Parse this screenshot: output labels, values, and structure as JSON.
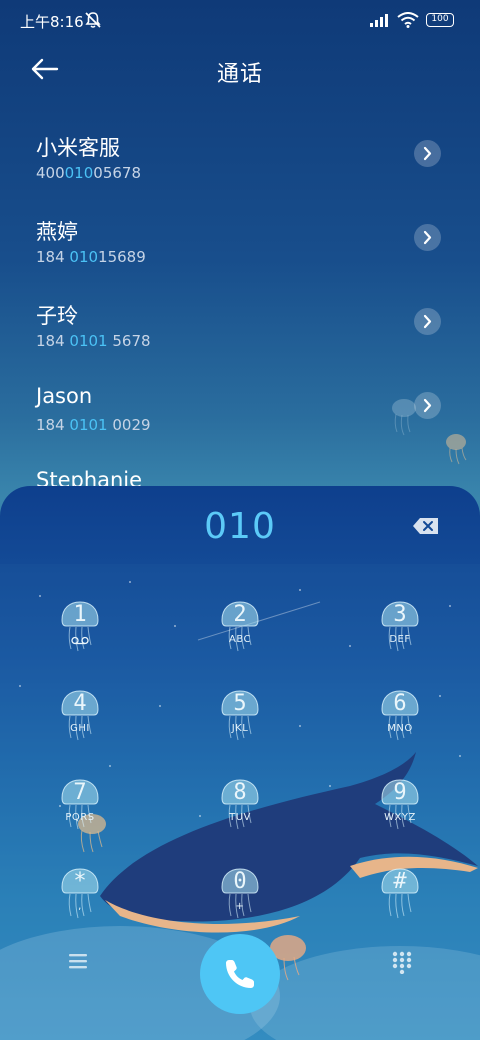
{
  "status": {
    "time": "上午8:16",
    "battery": "100"
  },
  "header": {
    "title": "通话"
  },
  "contacts": [
    {
      "name": "小米客服",
      "num_pre": "400",
      "num_hl": "010",
      "num_post": "05678"
    },
    {
      "name": "燕婷",
      "num_pre": "184 ",
      "num_hl": "010",
      "num_post": "15689"
    },
    {
      "name": "子玲",
      "num_pre": "184 ",
      "num_hl": "0101",
      "num_post": " 5678"
    },
    {
      "name": "Jason",
      "num_pre": "184 ",
      "num_hl": "0101",
      "num_post": " 0029"
    },
    {
      "name": "Stephanie",
      "num_pre": "",
      "num_hl": "",
      "num_post": ""
    }
  ],
  "dialer": {
    "input": "010",
    "keys": [
      {
        "digit": "1",
        "letters": ""
      },
      {
        "digit": "2",
        "letters": "ABC"
      },
      {
        "digit": "3",
        "letters": "DEF"
      },
      {
        "digit": "4",
        "letters": "GHI"
      },
      {
        "digit": "5",
        "letters": "JKL"
      },
      {
        "digit": "6",
        "letters": "MNO"
      },
      {
        "digit": "7",
        "letters": "PQRS"
      },
      {
        "digit": "8",
        "letters": "TUV"
      },
      {
        "digit": "9",
        "letters": "WXYZ"
      },
      {
        "digit": "*",
        "letters": ","
      },
      {
        "digit": "0",
        "letters": "+"
      },
      {
        "digit": "#",
        "letters": ""
      }
    ]
  },
  "colors": {
    "accent": "#4ec6f5",
    "highlight": "#4bc2f5",
    "sheet_top": "#0e3f8d"
  },
  "icons": [
    "back-arrow-icon",
    "mute-icon",
    "signal-icon",
    "wifi-icon",
    "chevron-right-icon",
    "backspace-icon",
    "voicemail-icon",
    "menu-icon",
    "phone-icon",
    "keypad-grid-icon"
  ]
}
